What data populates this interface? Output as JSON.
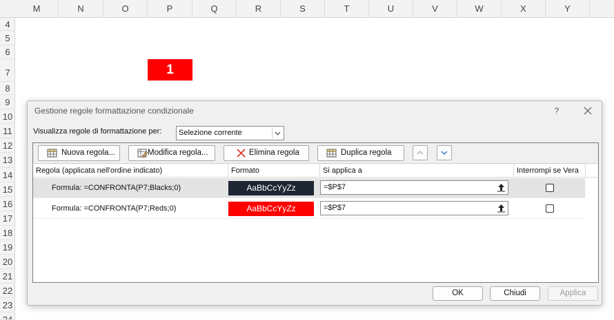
{
  "sheet": {
    "columns": [
      "M",
      "N",
      "O",
      "P",
      "Q",
      "R",
      "S",
      "T",
      "U",
      "V",
      "W",
      "X",
      "Y"
    ],
    "rows": [
      "4",
      "5",
      "6",
      "7",
      "8",
      "9",
      "10",
      "11",
      "12",
      "13",
      "14",
      "15",
      "16",
      "17",
      "18",
      "19",
      "20",
      "21",
      "22",
      "23",
      "24"
    ],
    "cell_value": "1"
  },
  "dialog": {
    "title": "Gestione regole formattazione condizionale",
    "help": "?",
    "show_label": "Visualizza regole di formattazione per:",
    "show_value": "Selezione corrente",
    "toolbar": {
      "new_rule": "Nuova regola...",
      "edit_rule": "Modifica regola...",
      "delete_rule": "Elimina regola",
      "duplicate_rule": "Duplica regola"
    },
    "columns": {
      "rule": "Regola (applicata nell'ordine indicato)",
      "format": "Formato",
      "applies_to": "Si applica a",
      "stop_if_true": "Interrompi se Vera"
    },
    "rules": [
      {
        "name": "Formula: =CONFRONTA(P7;Blacks;0)",
        "preview": "AaBbCcYyZz",
        "applies_to": "=$P$7",
        "fill": "#1e2633"
      },
      {
        "name": "Formula: =CONFRONTA(P7;Reds;0)",
        "preview": "AaBbCcYyZz",
        "applies_to": "=$P$7",
        "fill": "#ff0000"
      }
    ],
    "buttons": {
      "ok": "OK",
      "close": "Chiudi",
      "apply": "Applica"
    }
  }
}
